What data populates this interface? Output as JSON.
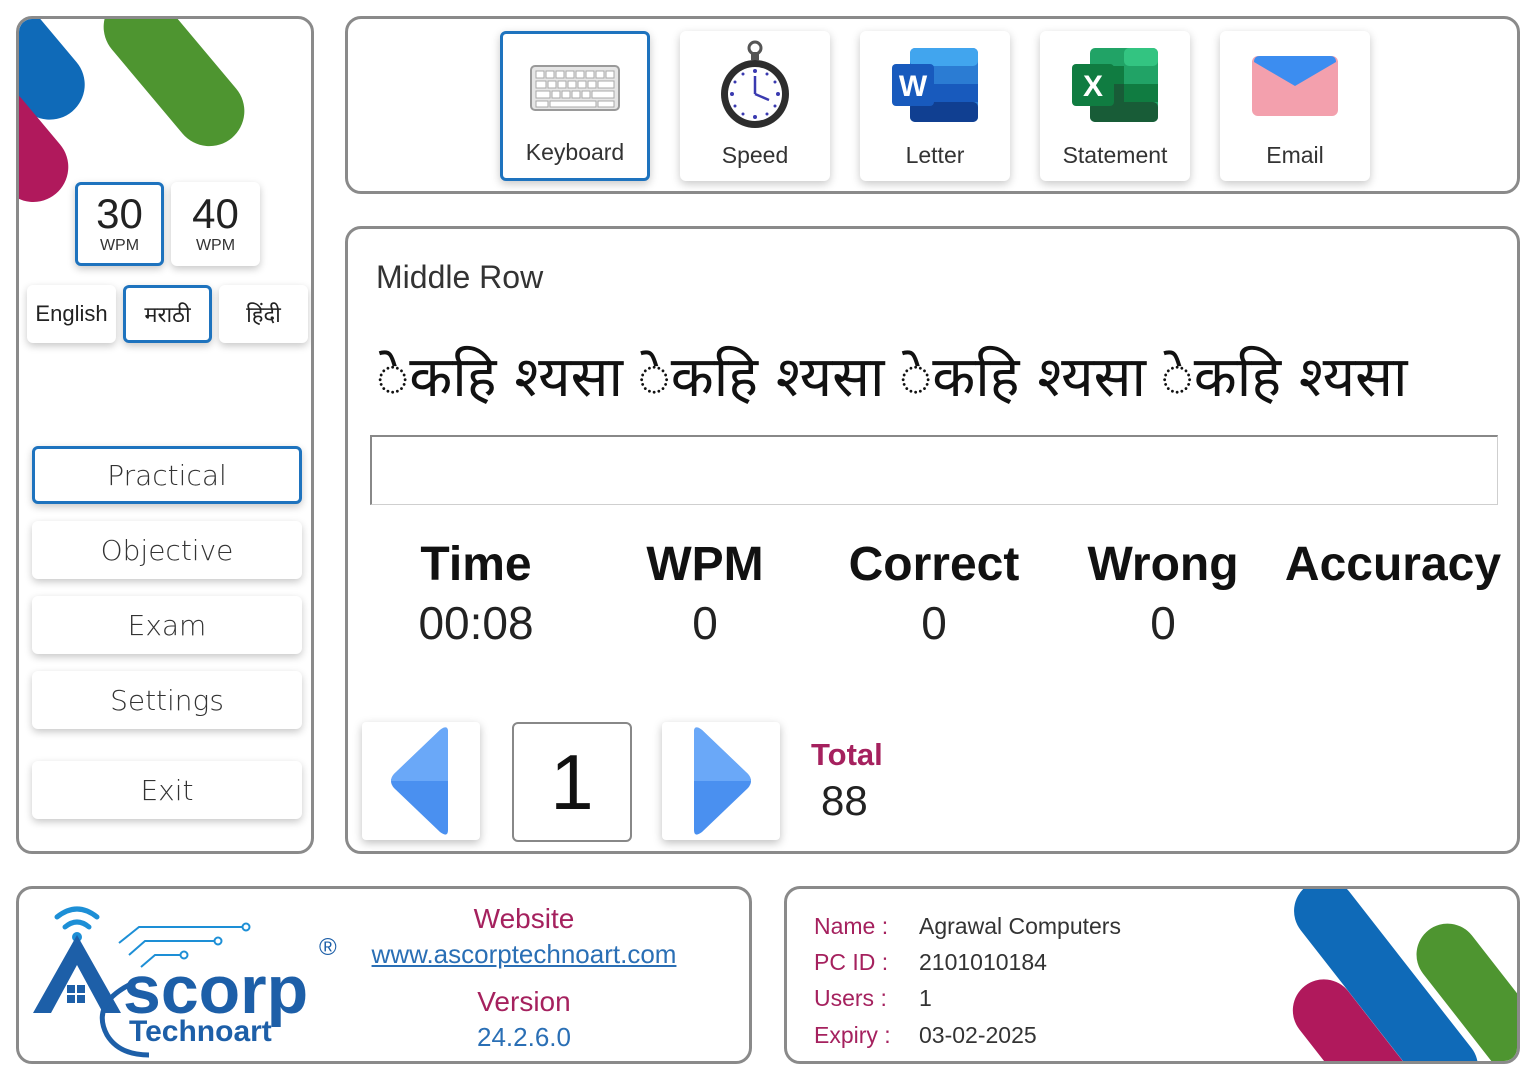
{
  "sidebar": {
    "colors": {
      "blue": "#0f6ab8",
      "green": "#4e9530",
      "magenta": "#b0195c",
      "active_border": "#1e73be"
    },
    "speed": [
      {
        "value": "30",
        "unit": "WPM",
        "active": true
      },
      {
        "value": "40",
        "unit": "WPM",
        "active": false
      }
    ],
    "languages": [
      {
        "label": "English",
        "active": false
      },
      {
        "label": "मराठी",
        "active": true
      },
      {
        "label": "हिंदी",
        "active": false
      }
    ],
    "menu": [
      {
        "label": "Practical",
        "active": true
      },
      {
        "label": "Objective",
        "active": false
      },
      {
        "label": "Exam",
        "active": false
      },
      {
        "label": "Settings",
        "active": false
      },
      {
        "label": "Exit",
        "active": false
      }
    ]
  },
  "toolbar": {
    "tools": [
      {
        "label": "Keyboard",
        "icon": "keyboard-icon",
        "active": true
      },
      {
        "label": "Speed",
        "icon": "stopwatch-icon",
        "active": false
      },
      {
        "label": "Letter",
        "icon": "word-icon",
        "active": false
      },
      {
        "label": "Statement",
        "icon": "excel-icon",
        "active": false
      },
      {
        "label": "Email",
        "icon": "email-icon",
        "active": false
      }
    ]
  },
  "practice": {
    "title": "Middle Row",
    "text": "ेकहि श्यसा ेकहि श्यसा ेकहि श्यसा ेकहि श्यसा",
    "input_value": "",
    "stats": {
      "time": {
        "label": "Time",
        "value": "00:08"
      },
      "wpm": {
        "label": "WPM",
        "value": "0"
      },
      "correct": {
        "label": "Correct",
        "value": "0"
      },
      "wrong": {
        "label": "Wrong",
        "value": "0"
      },
      "accuracy": {
        "label": "Accuracy",
        "value": ""
      }
    },
    "page": "1",
    "total_label": "Total",
    "total_value": "88"
  },
  "footer": {
    "brand": {
      "name": "scorp",
      "sub": "Technoart",
      "registered": "®"
    },
    "website_label": "Website",
    "website_url": "www.ascorptechnoart.com",
    "version_label": "Version",
    "version_value": "24.2.6.0",
    "license": {
      "name_label": "Name :",
      "name_value": "Agrawal Computers",
      "pcid_label": "PC ID  :",
      "pcid_value": "2101010184",
      "users_label": "Users  :",
      "users_value": "1",
      "expiry_label": "Expiry :",
      "expiry_value": "03-02-2025"
    }
  }
}
